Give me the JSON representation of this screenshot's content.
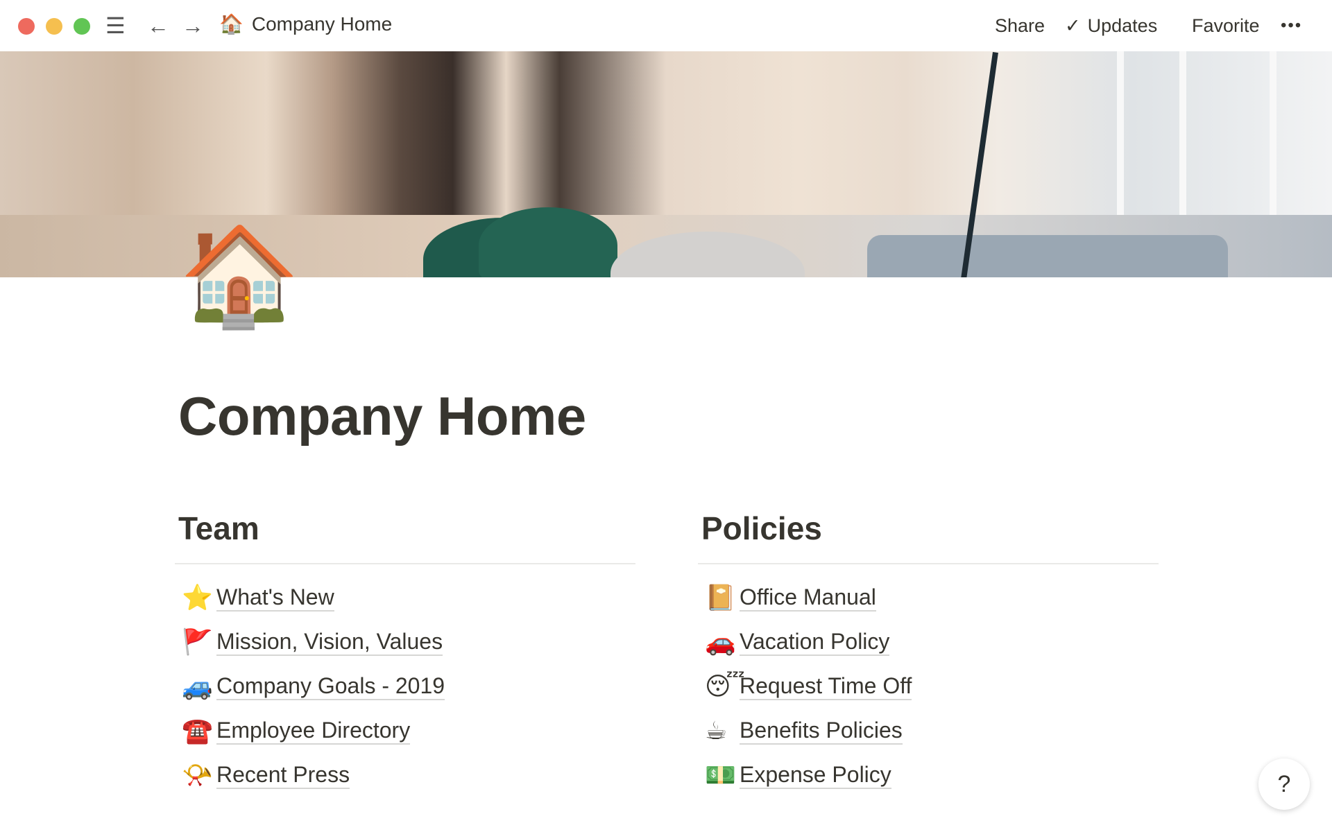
{
  "window": {
    "title_icon": "🏠",
    "title": "Company Home",
    "controls": [
      "close",
      "minimize",
      "zoom"
    ]
  },
  "topbar": {
    "share": "Share",
    "updates": "Updates",
    "favorite": "Favorite",
    "more": "•••",
    "icons": {
      "menu": "☰",
      "back": "←",
      "forward": "→",
      "check": "✓"
    }
  },
  "page": {
    "icon": "🏠",
    "title": "Company Home"
  },
  "team": {
    "heading": "Team",
    "items": [
      {
        "icon": "⭐",
        "label": "What's New"
      },
      {
        "icon": "🚩",
        "label": "Mission, Vision, Values"
      },
      {
        "icon": "🚙",
        "label": "Company Goals - 2019"
      },
      {
        "icon": "☎️",
        "label": "Employee Directory"
      },
      {
        "icon": "📯",
        "label": "Recent Press"
      }
    ]
  },
  "policies": {
    "heading": "Policies",
    "items": [
      {
        "icon": "📔",
        "label": "Office Manual"
      },
      {
        "icon": "🚗",
        "label": "Vacation Policy"
      },
      {
        "icon": "😴",
        "label": "Request Time Off"
      },
      {
        "icon": "☕",
        "label": "Benefits Policies"
      },
      {
        "icon": "💵",
        "label": "Expense Policy"
      }
    ]
  },
  "help": "?",
  "colors": {
    "close": "#ee6a5e",
    "minimize": "#f5bf4f",
    "zoom": "#61c554",
    "text": "#37352f"
  }
}
